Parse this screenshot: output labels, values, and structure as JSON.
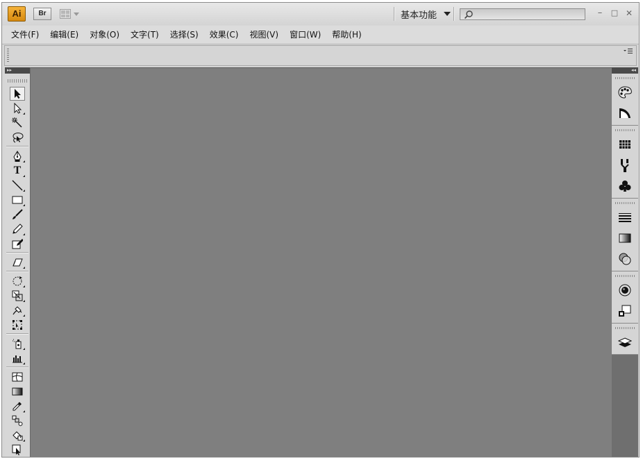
{
  "app": {
    "logo_text": "Ai",
    "bridge_label": "Br",
    "workspace_label": "基本功能",
    "search_placeholder": "",
    "window_controls": {
      "minimize": "–",
      "maximize": "□",
      "close": "✕"
    }
  },
  "menu": {
    "items": [
      "文件(F)",
      "编辑(E)",
      "对象(O)",
      "文字(T)",
      "选择(S)",
      "效果(C)",
      "视图(V)",
      "窗口(W)",
      "帮助(H)"
    ]
  },
  "tools_panel": {
    "collapse_glyph": "▸▸",
    "tools": [
      {
        "icon": "selection-icon"
      },
      {
        "icon": "direct-selection-icon"
      },
      {
        "icon": "magic-wand-icon"
      },
      {
        "icon": "lasso-icon"
      },
      {
        "icon": "pen-icon"
      },
      {
        "icon": "type-icon",
        "text": "T"
      },
      {
        "icon": "line-segment-icon"
      },
      {
        "icon": "rectangle-icon"
      },
      {
        "icon": "paintbrush-icon"
      },
      {
        "icon": "pencil-icon"
      },
      {
        "icon": "blob-brush-icon"
      },
      {
        "icon": "eraser-icon"
      },
      {
        "icon": "rotate-icon"
      },
      {
        "icon": "scale-icon"
      },
      {
        "icon": "warp-icon"
      },
      {
        "icon": "free-transform-icon"
      },
      {
        "icon": "symbol-sprayer-icon"
      },
      {
        "icon": "column-graph-icon"
      },
      {
        "icon": "mesh-icon"
      },
      {
        "icon": "gradient-icon"
      },
      {
        "icon": "eyedropper-icon"
      },
      {
        "icon": "blend-icon"
      },
      {
        "icon": "live-paint-bucket-icon"
      },
      {
        "icon": "live-paint-selection-icon"
      }
    ]
  },
  "dock": {
    "collapse_glyph": "◂◂",
    "groups": [
      [
        "color-icon",
        "color-guide-icon"
      ],
      [
        "swatches-icon",
        "brushes-icon",
        "symbols-icon"
      ],
      [
        "stroke-icon",
        "gradient-panel-icon",
        "transparency-icon"
      ],
      [
        "appearance-icon",
        "graphic-styles-icon"
      ],
      [
        "layers-icon"
      ]
    ]
  }
}
